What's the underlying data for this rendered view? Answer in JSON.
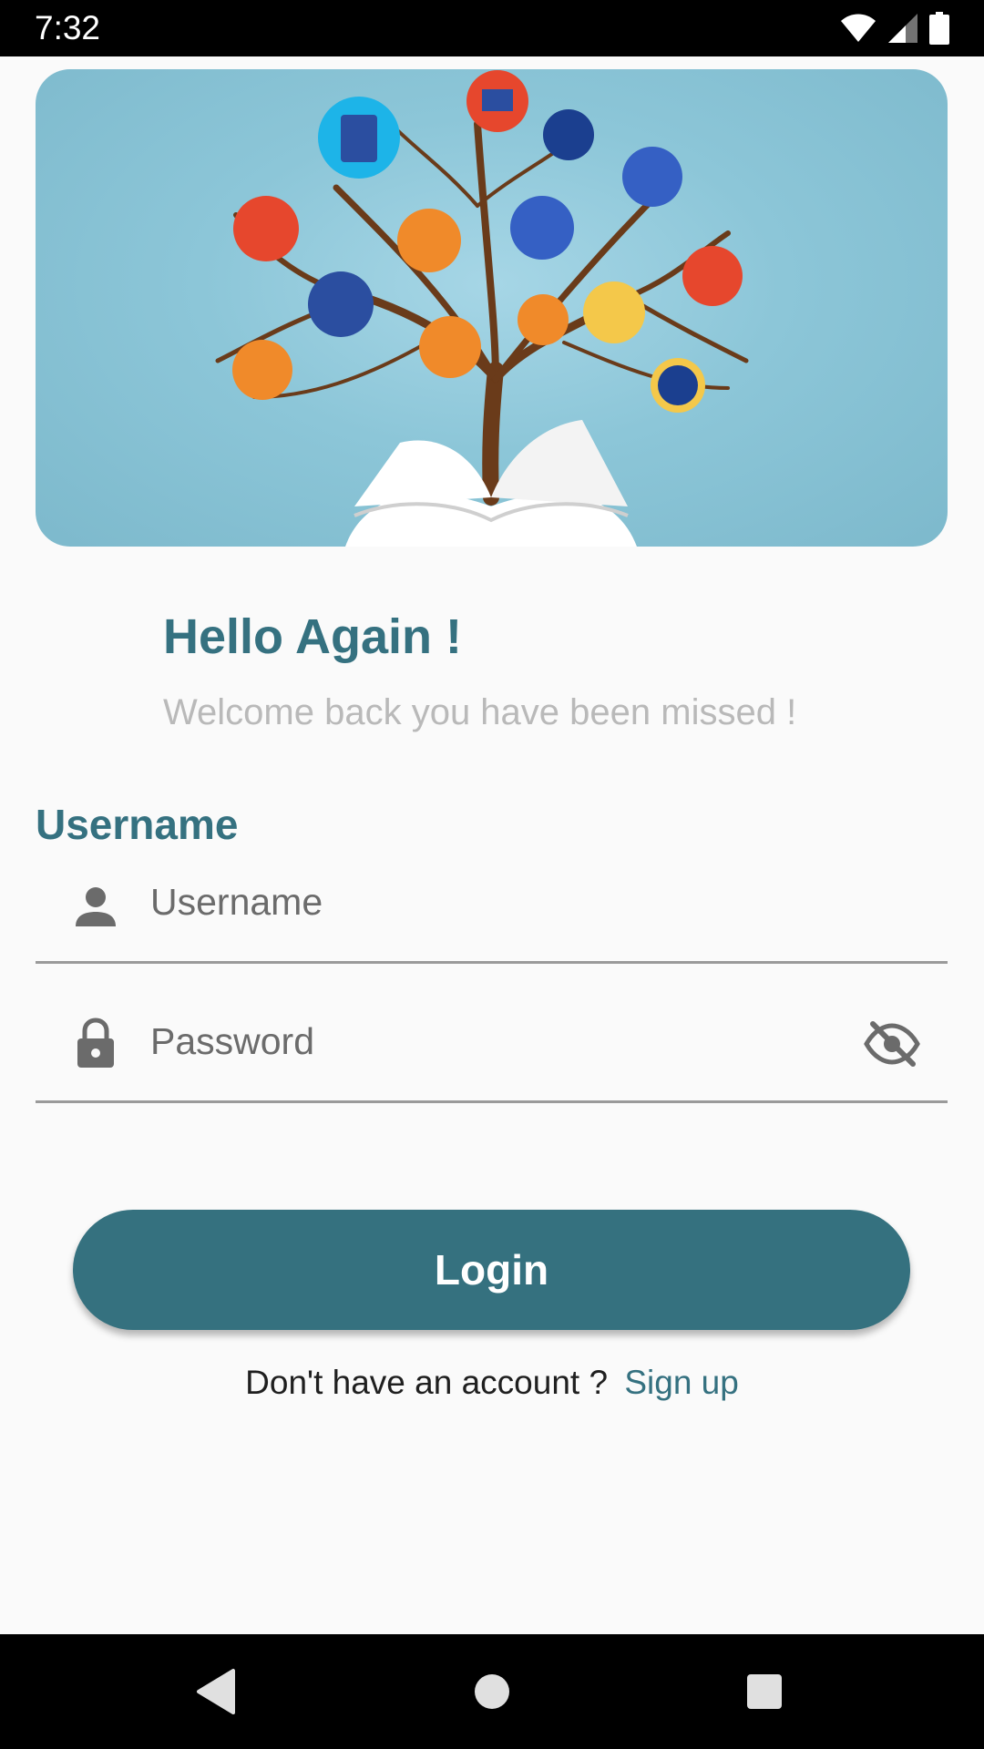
{
  "status_bar": {
    "time": "7:32",
    "icons": [
      "wifi-icon",
      "cellular-signal-icon",
      "battery-icon"
    ]
  },
  "hero": {
    "image": "book-knowledge-tree-illustration"
  },
  "login": {
    "title": "Hello Again !",
    "subtitle": "Welcome back you have been missed !",
    "username_heading": "Username",
    "username_placeholder": "Username",
    "password_placeholder": "Password",
    "login_button": "Login",
    "no_account_text": "Don't have an account ?",
    "signup_link": "Sign up"
  },
  "navigation": {
    "buttons": [
      "back-icon",
      "home-icon",
      "recents-icon"
    ]
  },
  "colors": {
    "primary": "#35717f",
    "subtitle": "#b9b9b9",
    "background": "#fafafa",
    "hero_background": "#8cc6d8"
  }
}
